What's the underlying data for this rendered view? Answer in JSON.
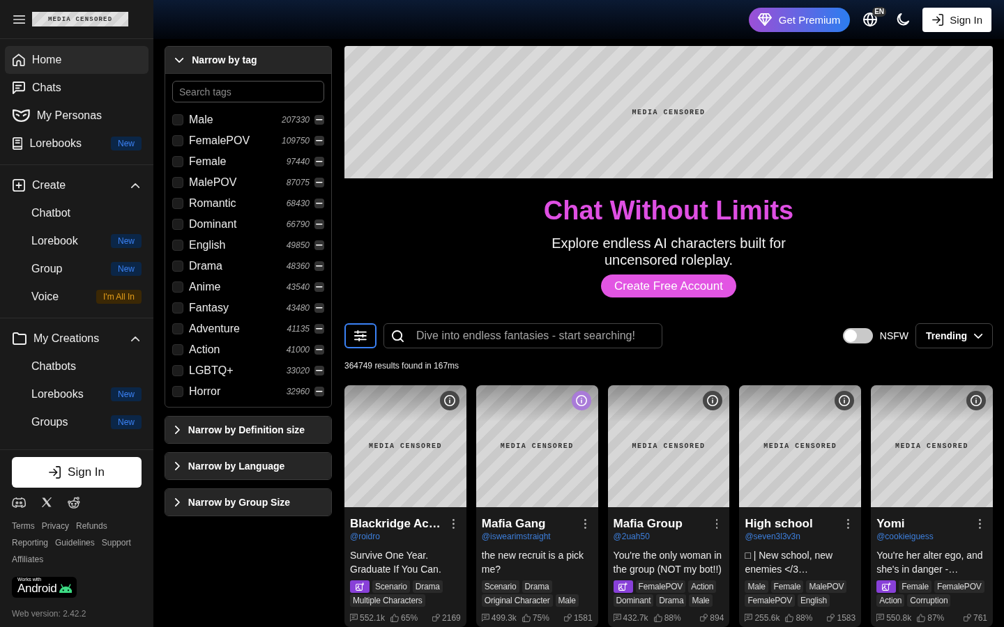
{
  "sidebar": {
    "logo": {
      "label": "MEDIA CENSORED"
    },
    "nav": [
      {
        "label": "Home",
        "selected": true
      },
      {
        "label": "Chats",
        "selected": false
      },
      {
        "label": "My Personas",
        "selected": false
      },
      {
        "label": "Lorebooks",
        "selected": false,
        "badge": {
          "text": "New",
          "kind": "new"
        }
      }
    ],
    "groups": [
      {
        "label": "Create",
        "expanded": true,
        "items": [
          {
            "label": "Chatbot",
            "selected": false
          },
          {
            "label": "Lorebook",
            "selected": false,
            "badge": {
              "text": "New",
              "kind": "new"
            }
          },
          {
            "label": "Group",
            "selected": false,
            "badge": {
              "text": "New",
              "kind": "new"
            }
          },
          {
            "label": "Voice",
            "selected": false,
            "badge": {
              "text": "I'm All In",
              "kind": "premium"
            }
          }
        ]
      },
      {
        "label": "My Creations",
        "expanded": true,
        "items": [
          {
            "label": "Chatbots",
            "selected": false
          },
          {
            "label": "Lorebooks",
            "selected": false,
            "badge": {
              "text": "New",
              "kind": "new"
            }
          },
          {
            "label": "Groups",
            "selected": false,
            "badge": {
              "text": "New",
              "kind": "new"
            }
          }
        ]
      }
    ],
    "sign_in": "Sign In",
    "links": [
      "Terms",
      "Privacy",
      "Refunds",
      "Reporting",
      "Guidelines",
      "Support",
      "Affiliates"
    ],
    "android_badge": {
      "caption": "Works with",
      "title": "Android"
    },
    "version": "Web version: 2.42.2"
  },
  "topbar": {
    "premium": "Get Premium",
    "language": "EN",
    "sign_in": "Sign In"
  },
  "filters": [
    {
      "title": "Narrow by tag",
      "expanded": true,
      "search": {
        "placeholder": "Search tags"
      },
      "tags": [
        {
          "name": "Male",
          "count": "207330",
          "checked": false
        },
        {
          "name": "FemalePOV",
          "count": "109750",
          "checked": false
        },
        {
          "name": "Female",
          "count": "97440",
          "checked": false
        },
        {
          "name": "MalePOV",
          "count": "87075",
          "checked": false
        },
        {
          "name": "Romantic",
          "count": "68430",
          "checked": false
        },
        {
          "name": "Dominant",
          "count": "66790",
          "checked": false
        },
        {
          "name": "English",
          "count": "49850",
          "checked": false
        },
        {
          "name": "Drama",
          "count": "48360",
          "checked": false
        },
        {
          "name": "Anime",
          "count": "43540",
          "checked": false
        },
        {
          "name": "Fantasy",
          "count": "43480",
          "checked": false
        },
        {
          "name": "Adventure",
          "count": "41135",
          "checked": false
        },
        {
          "name": "Action",
          "count": "41000",
          "checked": false
        },
        {
          "name": "LGBTQ+",
          "count": "33020",
          "checked": false
        },
        {
          "name": "Horror",
          "count": "32960",
          "checked": false
        }
      ]
    },
    {
      "title": "Narrow by Definition size",
      "expanded": false
    },
    {
      "title": "Narrow by Language",
      "expanded": false
    },
    {
      "title": "Narrow by Group Size",
      "expanded": false
    }
  ],
  "hero": {
    "banner": {
      "label": "MEDIA CENSORED"
    },
    "title": "Chat Without Limits",
    "subtitle": "Explore endless AI characters built for uncensored roleplay.",
    "cta": "Create Free Account"
  },
  "search": {
    "placeholder": "Dive into endless fantasies - start searching!",
    "nsfw": {
      "label": "NSFW",
      "on": false
    },
    "sort": "Trending"
  },
  "results": "364749 results found in 167ms",
  "cards": [
    {
      "image": {
        "label": "MEDIA CENSORED"
      },
      "info_highlighted": false,
      "title": "Blackridge Ac…",
      "handle": "@roidro",
      "description": "Survive One Year. Graduate If You Can.",
      "image_gen": true,
      "tags": [
        "Scenario",
        "Drama",
        "Multiple Characters"
      ],
      "chats": "552.1k",
      "rating": "65%",
      "tokens": "2169"
    },
    {
      "image": {
        "label": "MEDIA CENSORED"
      },
      "info_highlighted": true,
      "title": "Mafia Gang",
      "handle": "@iswearimstraight",
      "description": "the new recruit is a pick me?",
      "image_gen": false,
      "tags": [
        "Scenario",
        "Drama",
        "Original Character",
        "Male"
      ],
      "chats": "499.3k",
      "rating": "75%",
      "tokens": "1581"
    },
    {
      "image": {
        "label": "MEDIA CENSORED"
      },
      "info_highlighted": false,
      "title": "Mafia Group",
      "handle": "@2uah50",
      "description": "You're the only woman in the group (NOT my bot!!)",
      "image_gen": true,
      "tags": [
        "FemalePOV",
        "Action",
        "Dominant",
        "Drama",
        "Male"
      ],
      "chats": "432.7k",
      "rating": "88%",
      "tokens": "894"
    },
    {
      "image": {
        "label": "MEDIA CENSORED"
      },
      "info_highlighted": false,
      "title": "High school",
      "handle": "@seven3l3v3n",
      "description": "□ | New school, new enemies </3…",
      "image_gen": false,
      "tags": [
        "Male",
        "Female",
        "MalePOV",
        "FemalePOV",
        "English"
      ],
      "chats": "255.6k",
      "rating": "88%",
      "tokens": "1583"
    },
    {
      "image": {
        "label": "MEDIA CENSORED"
      },
      "info_highlighted": false,
      "title": "Yomi",
      "handle": "@cookieiguess",
      "description": "You're her alter ego, and she's in danger -…",
      "image_gen": true,
      "tags": [
        "Female",
        "FemalePOV",
        "Action",
        "Corruption"
      ],
      "chats": "550.8k",
      "rating": "87%",
      "tokens": "761"
    }
  ]
}
